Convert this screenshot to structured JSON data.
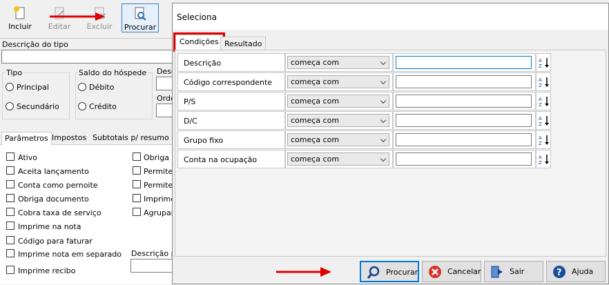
{
  "toolbar": {
    "incluir": "Incluir",
    "editar": "Editar",
    "excluir": "Excluir",
    "procurar": "Procurar"
  },
  "form": {
    "descricao_do_tipo": "Descrição do tipo",
    "tipo_label": "Tipo",
    "tipo_principal": "Principal",
    "tipo_secundario": "Secundário",
    "saldo_label": "Saldo do hóspede",
    "saldo_debito": "Débito",
    "saldo_credito": "Crédito",
    "desc_partial": "Desc",
    "orde_partial": "Orde",
    "descricao_p": "Descrição p"
  },
  "bg_tabs": [
    "Parâmetros",
    "Impostos",
    "Subtotais p/ resumo d"
  ],
  "checkboxes_left": [
    "Ativo",
    "Aceita lançamento",
    "Conta como pernoite",
    "Obriga documento",
    "Cobra taxa de serviço",
    "Imprime na nota",
    "Código para faturar",
    "Imprime nota em separado",
    "Imprime recibo"
  ],
  "checkboxes_right": [
    "Obriga c",
    "Permite",
    "Permite",
    "Imprime",
    "Agrupar"
  ],
  "dialog": {
    "title": "Seleciona",
    "tabs": [
      "Condições",
      "Resultado"
    ],
    "rows": [
      {
        "label": "Descrição",
        "op": "começa com",
        "value": ""
      },
      {
        "label": "Código correspondente",
        "op": "começa com",
        "value": ""
      },
      {
        "label": "P/S",
        "op": "começa com",
        "value": ""
      },
      {
        "label": "D/C",
        "op": "começa com",
        "value": ""
      },
      {
        "label": "Grupo fixo",
        "op": "começa com",
        "value": ""
      },
      {
        "label": "Conta na ocupação",
        "op": "começa com",
        "value": ""
      }
    ],
    "buttons": {
      "procurar": "Procurar",
      "cancelar": "Cancelar",
      "sair": "Sair",
      "ajuda": "Ajuda"
    }
  },
  "colors": {
    "highlight_red": "#e00000",
    "focus_blue": "#0078d7"
  }
}
